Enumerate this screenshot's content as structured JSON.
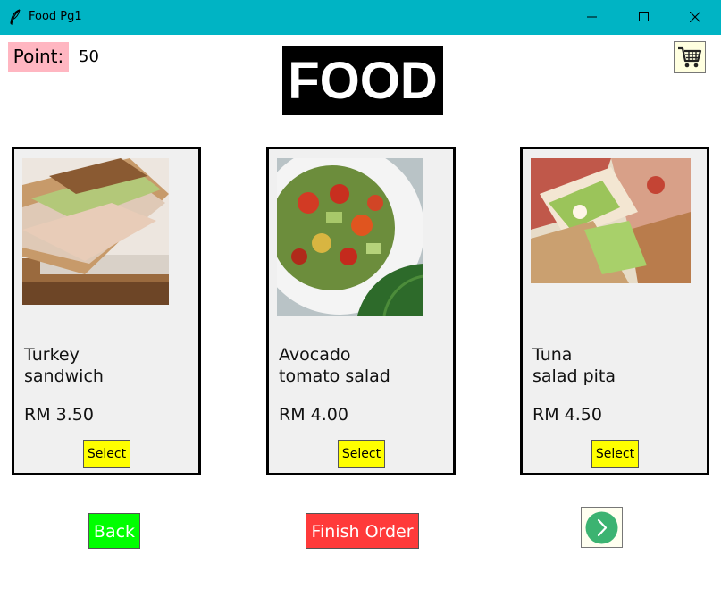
{
  "window": {
    "title": "Food Pg1",
    "app_icon": "feather-icon",
    "controls": [
      "minimize-icon",
      "maximize-icon",
      "close-icon"
    ]
  },
  "header": {
    "point_label": "Point:",
    "point_value": "50",
    "title": "FOOD",
    "cart_icon": "shopping-cart-icon"
  },
  "items": [
    {
      "name_line1": "Turkey",
      "name_line2": "sandwich",
      "price": "RM 3.50",
      "select_label": "Select",
      "image": "turkey-sandwich-photo"
    },
    {
      "name_line1": "Avocado",
      "name_line2": "tomato salad",
      "price": "RM 4.00",
      "select_label": "Select",
      "image": "avocado-tomato-salad-photo"
    },
    {
      "name_line1": "Tuna",
      "name_line2": "salad pita",
      "price": "RM 4.50",
      "select_label": "Select",
      "image": "tuna-salad-pita-photo"
    }
  ],
  "footer": {
    "back_label": "Back",
    "finish_label": "Finish Order",
    "next_icon": "chevron-right-circle-icon"
  },
  "colors": {
    "titlebar": "#00b4c4",
    "point_bg": "#ffb6c1",
    "select_bg": "#ffff00",
    "back_bg": "#00ff00",
    "finish_bg": "#ff3a3a",
    "next_circle": "#3cb371"
  }
}
